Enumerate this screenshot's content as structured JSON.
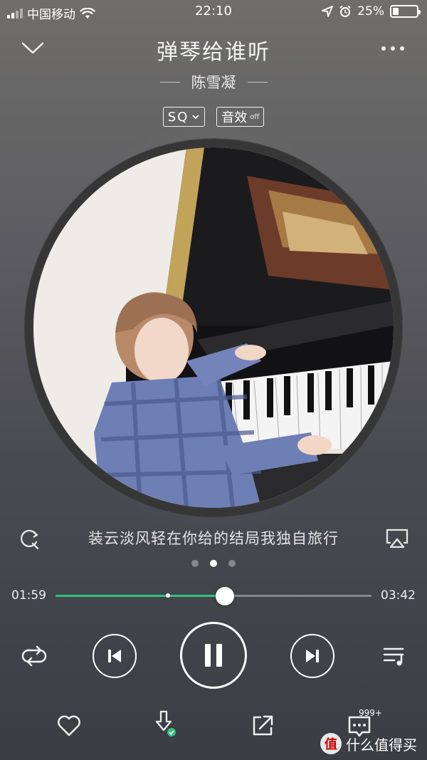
{
  "status_bar": {
    "carrier": "中国移动",
    "time": "22:10",
    "battery": "25%",
    "battery_level": 0.25
  },
  "header": {
    "title": "弹琴给谁听",
    "artist": "陈雪凝"
  },
  "tags": {
    "quality": "SQ",
    "effect": "音效",
    "effect_state": "off"
  },
  "lyric": "装云淡风轻在你给的结局我独自旅行",
  "page_indicator": {
    "count": 3,
    "active": 1
  },
  "progress": {
    "current": "01:59",
    "total": "03:42",
    "played_fraction": 0.536,
    "buffered_fraction": 0.35
  },
  "actions": {
    "comment_count": "999+"
  },
  "watermark": {
    "text": "什么值得买",
    "logo_char": "值"
  },
  "colors": {
    "accent": "#31c27c"
  },
  "icons": [
    "chevron-down-icon",
    "more-icon",
    "wifi-icon",
    "location-icon",
    "alarm-icon",
    "mv-icon",
    "airplay-icon",
    "repeat-icon",
    "previous-icon",
    "pause-icon",
    "next-icon",
    "playlist-icon",
    "heart-icon",
    "download-icon",
    "share-icon",
    "comment-icon"
  ]
}
